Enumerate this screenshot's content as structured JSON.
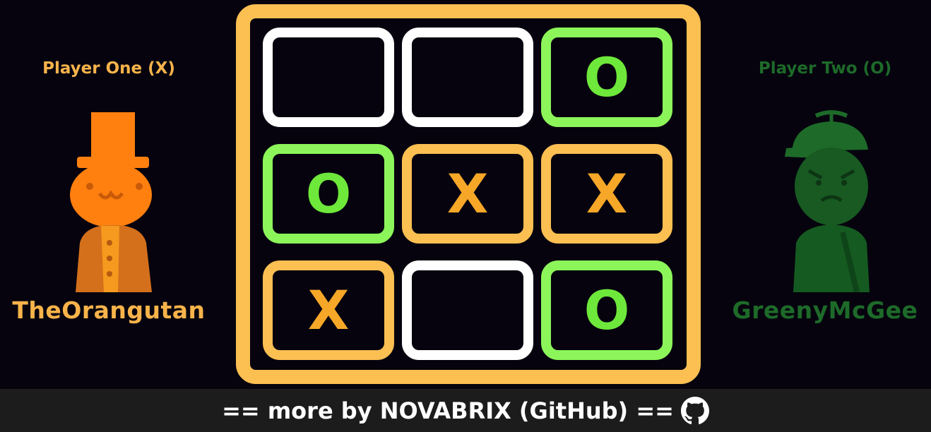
{
  "players": {
    "one": {
      "label": "Player One (X)",
      "name": "TheOrangutan",
      "color": "#f8b34a"
    },
    "two": {
      "label": "Player Two (O)",
      "name": "GreenyMcGee",
      "color": "#1d6a29"
    }
  },
  "board": {
    "cells": [
      "",
      "",
      "O",
      "O",
      "X",
      "X",
      "X",
      "",
      "O"
    ]
  },
  "footer": {
    "link_text": "== more by NOVABRIX (GitHub) ==",
    "icon": "github-icon"
  },
  "colors": {
    "background": "#06030e",
    "x_accent": "#fbbf52",
    "o_accent": "#8cf55a",
    "empty_cell_border": "#ffffff",
    "footer_bg": "#1c1c1c"
  }
}
